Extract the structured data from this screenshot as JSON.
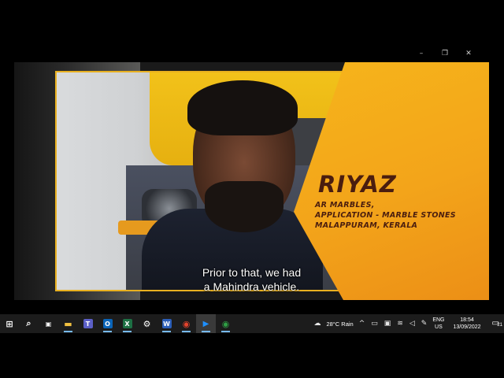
{
  "window": {
    "minimize_glyph": "–",
    "maximize_glyph": "❐",
    "close_glyph": "✕"
  },
  "video": {
    "name": "RIYAZ",
    "info_line1": "AR MARBLES,",
    "info_line2": "APPLICATION - MARBLE STONES",
    "info_line3": "MALAPPURAM, KERALA",
    "subtitle_line1": "Prior to that, we had",
    "subtitle_line2": "a Mahindra vehicle."
  },
  "taskbar": {
    "apps": [
      {
        "name": "start-icon",
        "glyph": "⊞"
      },
      {
        "name": "search-icon",
        "glyph": "⌕"
      },
      {
        "name": "task-view-icon",
        "glyph": "▣"
      },
      {
        "name": "file-explorer-icon",
        "glyph": "▬",
        "color": "#f0c040"
      },
      {
        "name": "teams-icon",
        "glyph": "T",
        "color": "#5b5fc7"
      },
      {
        "name": "outlook-icon",
        "glyph": "O",
        "color": "#0a64b8"
      },
      {
        "name": "excel-icon",
        "glyph": "X",
        "color": "#1d7044"
      },
      {
        "name": "settings-icon",
        "glyph": "⚙"
      },
      {
        "name": "word-icon",
        "glyph": "W",
        "color": "#2b5eb8"
      },
      {
        "name": "chrome-icon",
        "glyph": "◉",
        "color": "#e4432d"
      },
      {
        "name": "media-player-icon",
        "glyph": "▶",
        "color": "#1e90ff"
      },
      {
        "name": "chrome-2-icon",
        "glyph": "◉",
        "color": "#2f9e44"
      }
    ],
    "weather": "28°C  Rain",
    "language_top": "ENG",
    "language_bottom": "US",
    "time": "18:54",
    "date": "13/09/2022",
    "notification_count": "21"
  }
}
